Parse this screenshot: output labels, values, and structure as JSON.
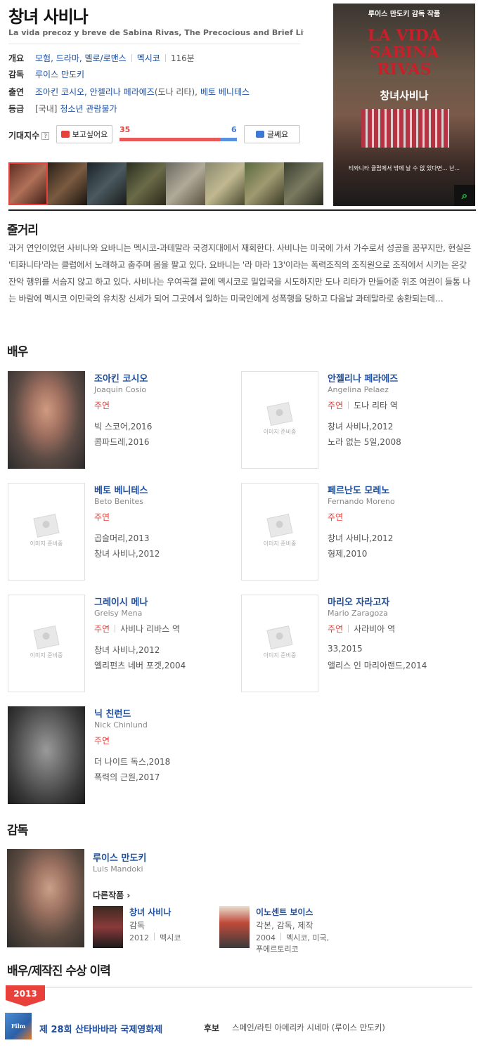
{
  "movie": {
    "title": "창녀 사비나",
    "subtitle": "La vida precoz y breve de Sabina Rivas, The Precocious and Brief Life...",
    "info": {
      "overview_label": "개요",
      "genres": "모험, 드라마, 멜로/로맨스",
      "country": "멕시코",
      "runtime": "116분",
      "director_label": "감독",
      "director": "루이스 만도키",
      "cast_label": "출연",
      "cast_main": "조아킨 코시오, 안젤리나 페라에즈",
      "cast_role": "(도나 리타),",
      "cast_last": "베토 베니테스",
      "rating_label": "등급",
      "rating_prefix": "[국내]",
      "rating": "청소년 관람불가"
    },
    "expect": {
      "label": "기대지수",
      "help": "?",
      "want_label": "보고싶어요",
      "want_count": "35",
      "nope_label": "글쎄요",
      "nope_count": "6",
      "want_fraction": 0.854
    },
    "poster": {
      "top_text": "루이스 만도키 감독 작품",
      "big_title": "LA VIDA\nSABINA\nRIVAS",
      "kr_title": "창녀사비나",
      "bottom_text": "티와니타 클럽에서 밖에 날 수 없 있다면... 난..."
    }
  },
  "synopsis": {
    "heading": "줄거리",
    "text": "과거 연인이었던 사비나와 요바니는 멕시코-과테말라 국경지대에서 재회한다. 사비나는 미국에 가서 가수로서 성공을 꿈꾸지만, 현실은 '티화니타'라는 클럽에서 노래하고 춤추며 몸을 팔고 있다. 요바니는 '라 마라 13'이라는 폭력조직의 조직원으로 조직에서 시키는 온갖 잔악 행위를 서슴지 않고 하고 있다. 사비나는 우여곡절 끝에 멕시코로 밀입국을 시도하지만 도나 리타가 만들어준 위조 여권이 들통 나는 바람에 멕시코 이민국의 유치장 신세가 되어 그곳에서 일하는 미국인에게 성폭행을 당하고 다음날 과테말라로 송환되는데…"
  },
  "actors_heading": "배우",
  "placeholder_text": "이미지 준비중",
  "actors": [
    {
      "name": "조아킨 코시오",
      "en": "Joaquin Cosio",
      "role": "주연",
      "character": "",
      "works": [
        "빅 스코어,2016",
        "콤파드레,2016"
      ]
    },
    {
      "name": "안젤리나 페라에즈",
      "en": "Angelina Pelaez",
      "role": "주연",
      "character": "도나 리타 역",
      "works": [
        "창녀 사비나,2012",
        "노라 없는 5일,2008"
      ]
    },
    {
      "name": "베토 베니테스",
      "en": "Beto Benites",
      "role": "주연",
      "character": "",
      "works": [
        "곱슬머리,2013",
        "창녀 사비나,2012"
      ]
    },
    {
      "name": "페르난도 모레노",
      "en": "Fernando Moreno",
      "role": "주연",
      "character": "",
      "works": [
        "창녀 사비나,2012",
        "형제,2010"
      ]
    },
    {
      "name": "그레이시 메나",
      "en": "Greisy Mena",
      "role": "주연",
      "character": "사비나 리바스 역",
      "works": [
        "창녀 사비나,2012",
        "엘리펀츠 네버 포겟,2004"
      ]
    },
    {
      "name": "마리오 자라고자",
      "en": "Mario Zaragoza",
      "role": "주연",
      "character": "사라비아 역",
      "works": [
        "33,2015",
        "앨리스 인 마리아랜드,2014"
      ]
    },
    {
      "name": "닉 친런드",
      "en": "Nick Chinlund",
      "role": "주연",
      "character": "",
      "works": [
        "더 나이트 독스,2018",
        "폭력의 근원,2017"
      ]
    }
  ],
  "director": {
    "heading": "감독",
    "name": "루이스 만도키",
    "en": "Luis Mandoki",
    "other_label": "다른작품 ›",
    "works": [
      {
        "title": "창녀 사비나",
        "role": "감독",
        "year": "2012",
        "country": "멕시코"
      },
      {
        "title": "이노센트 보이스",
        "role": "각본, 감독, 제작",
        "year": "2004",
        "country": "멕시코, 미국, 푸에르토리코"
      }
    ]
  },
  "awards": {
    "heading": "배우/제작진 수상 이력",
    "year": "2013",
    "icon_text": "Film",
    "festival": "제 28회 산타바바라 국제영화제",
    "type": "후보",
    "detail": "스페인/라틴 아메리카 시네마 (루이스 만도키)"
  }
}
